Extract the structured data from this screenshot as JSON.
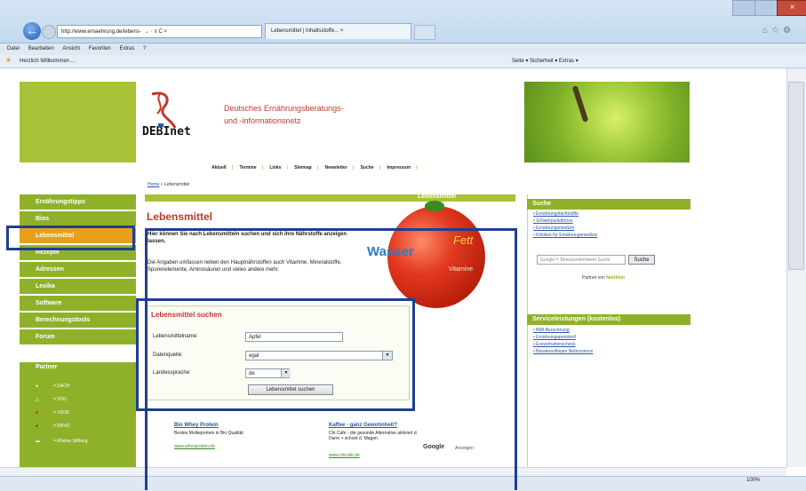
{
  "browser": {
    "address_text": "http://www.ernaehrung.de/lebens-  → · ≡ Ć ×",
    "tab_label": "Lebensmittel | Inhaltsstoffe... ×",
    "menu": [
      "Datei",
      "Bearbeiten",
      "Ansicht",
      "Favoriten",
      "Extras",
      "?"
    ],
    "favorite_link": "Herzlich Willkommen ...",
    "commandbar": "Seite ▾  Sicherheit ▾  Extras ▾",
    "zoom": "100%"
  },
  "site": {
    "logo_text": "DEBInet",
    "tagline_1": "Deutsches Ernährungsberatungs-",
    "tagline_2": "und -informationsnetz",
    "topnav": [
      "Aktuell",
      "Termine",
      "Links",
      "Sitemap",
      "Newsletter",
      "Suche",
      "Impressum"
    ]
  },
  "breadcrumb": {
    "home": "Home",
    "current": "Lebensmittel"
  },
  "leftnav": [
    {
      "label": "Ernährungstipps",
      "active": false
    },
    {
      "label": "Bios",
      "active": false
    },
    {
      "label": "Lebensmittel",
      "active": true
    },
    {
      "label": "Rezepte",
      "active": false
    },
    {
      "label": "Adressen",
      "active": false
    },
    {
      "label": "Lexika",
      "active": false
    },
    {
      "label": "Software",
      "active": false
    },
    {
      "label": "Berechnungstools",
      "active": false
    },
    {
      "label": "Forum",
      "active": false
    }
  ],
  "partner": {
    "title": "Partner",
    "logos": [
      "= DACH",
      "= VDD",
      "= VDOE",
      "= DRVD",
      "= Rheine Stiftung"
    ]
  },
  "content": {
    "section_header": "Lebensmittel",
    "title": "Lebensmittel",
    "intro": "Hier können Sie nach Lebensmitteln suchen und sich ihre Nährstoffe anzeigen lassen.",
    "description": "Die Angaben umfassen neben den Hauptnährstoffen auch Vitamine, Mineralstoffe, Spurenelemente, Aminosäuren und vieles andere mehr.",
    "words": {
      "wasser": "Wasser",
      "fett": "Fett",
      "vitamine": "Vitamine"
    }
  },
  "search_form": {
    "title": "Lebensmittel suchen",
    "name_label": "Lebensmittelname:",
    "name_value": "Apfel",
    "source_label": "Datenquelle:",
    "source_value": "egal",
    "lang_label": "Landessprache:",
    "lang_value": "de",
    "submit_label": "Lebensmittel suchen"
  },
  "ads": [
    {
      "title": "Bio Whey Protein",
      "text": "Bestes Molkeprotein in Bio Qualität",
      "url": "www.wheyprotein.de"
    },
    {
      "title": "Kaffee - ganz Gewohnheit?",
      "text": "Chi Cafe - die gesunde Alternative aktiviert d. Darm + schont d. Magen",
      "url": "www.chicafe.de"
    }
  ],
  "ads_badge": {
    "google": "Google",
    "suffix": "Anzeigen"
  },
  "right": {
    "search_title": "Suche",
    "search_links": [
      "Ernährungsfachkräfte",
      "Schwerpunktbörse",
      "Ernährungsmedizin",
      "Kliniken für Ernährungsmedizin"
    ],
    "search_placeholder": "Google™ Benutzerdefinierte Suche",
    "search_button": "Suche",
    "partner_label": "Partner von",
    "partner_brand": "Nutrition",
    "service_title": "Serviceleistungen (kostenlos)",
    "service_links": [
      "BMI-Berechnung",
      "Ernährungsprotokoll",
      "Essverhaltenscheck",
      "Beratersoftware Nutriscience"
    ]
  },
  "colors": {
    "brand_green": "#8fb12a",
    "active_orange": "#e6a01a",
    "title_red": "#c0392b",
    "annotation_blue": "#1f3f8f"
  }
}
